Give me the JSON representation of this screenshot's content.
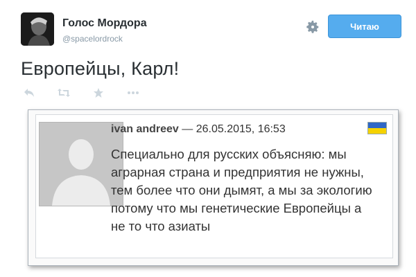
{
  "tweet": {
    "author_name": "Голос Мордора",
    "author_handle": "@spacelordrock",
    "follow_label": "Читаю",
    "text": "Европейцы, Карл!",
    "actions": [
      "reply-icon",
      "retweet-icon",
      "favorite-icon",
      "more-icon"
    ]
  },
  "quoted": {
    "author_name": "ivan andreev",
    "date": " — 26.05.2015, 16:53",
    "flag_colors": [
      "#2f67c6",
      "#f5d200"
    ],
    "text": "Специально для русских объясняю: мы аграрная страна и предприятия не нужны, тем более что они дымят, а мы за экологию потому что мы генетические Европейцы а не то что азиаты"
  },
  "colors": {
    "accent": "#55acee",
    "muted": "#8899a6",
    "text": "#292f33"
  }
}
